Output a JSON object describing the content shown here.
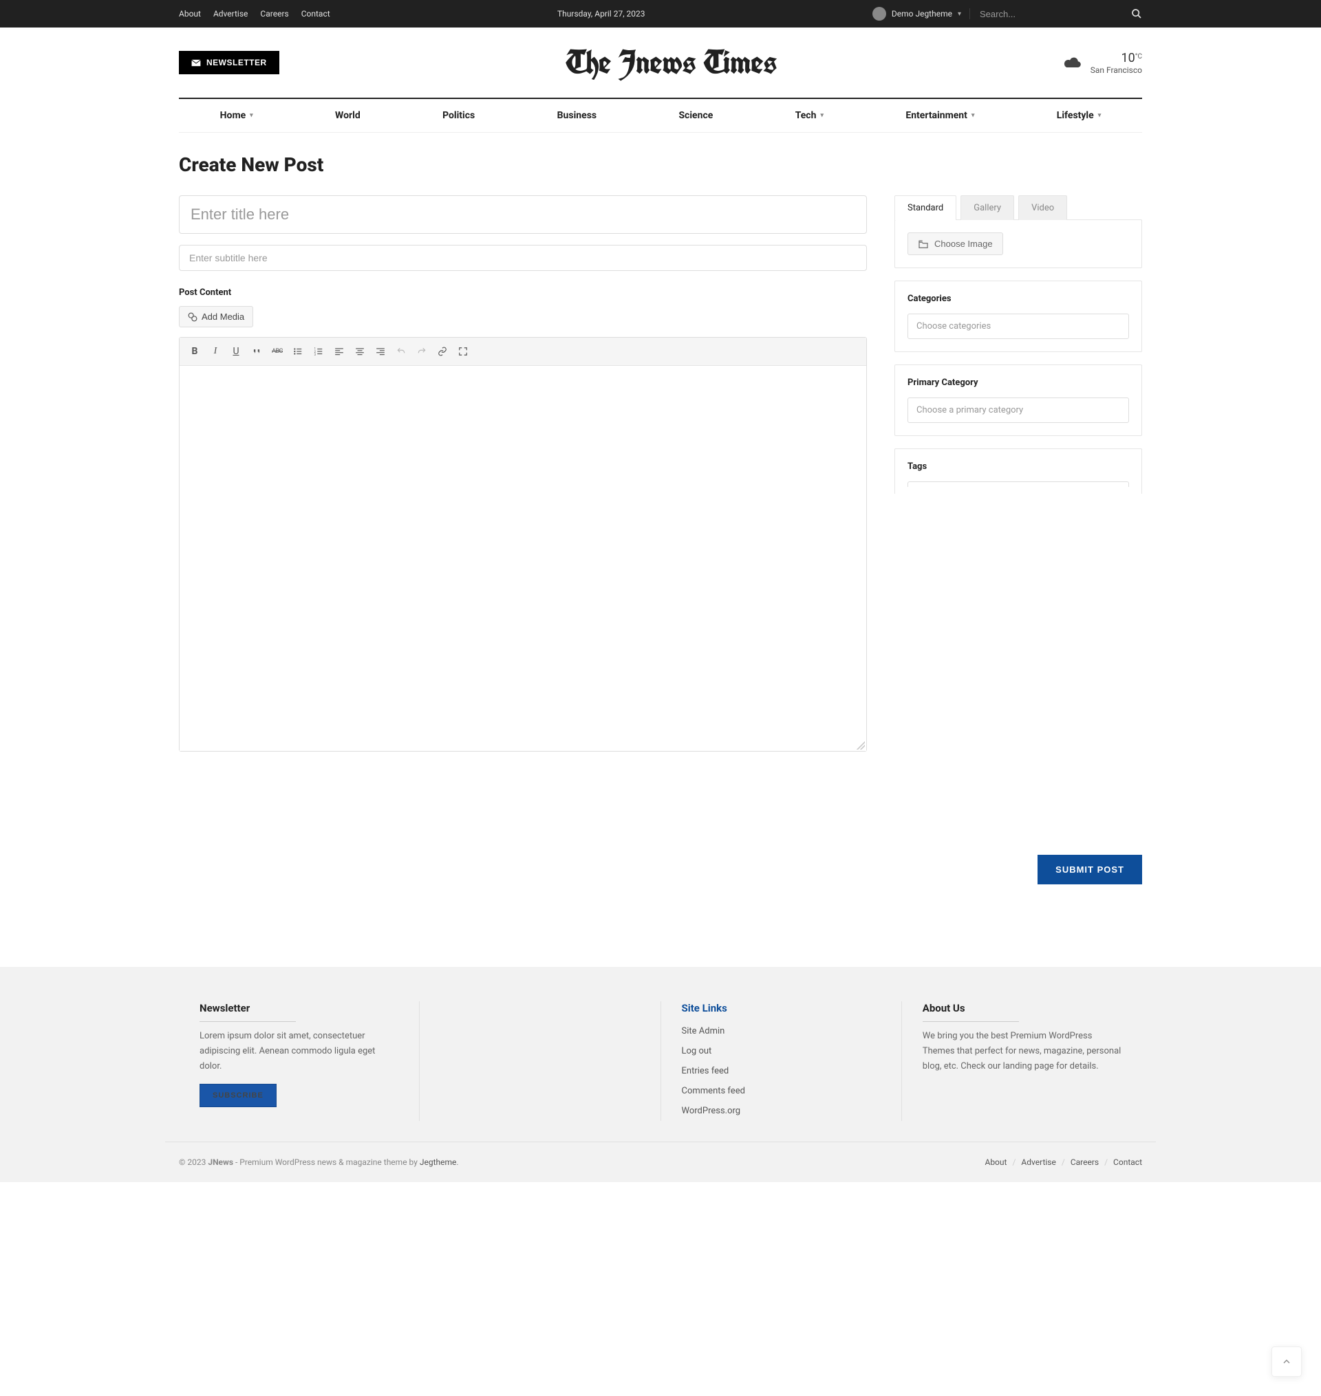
{
  "topbar": {
    "links": [
      "About",
      "Advertise",
      "Careers",
      "Contact"
    ],
    "date": "Thursday, April 27, 2023",
    "user": "Demo Jegtheme",
    "search_placeholder": "Search..."
  },
  "header": {
    "newsletter_label": "NEWSLETTER",
    "logo": "The Jnews Times",
    "weather": {
      "temp": "10",
      "unit": "°C",
      "city": "San Francisco"
    }
  },
  "nav": [
    {
      "label": "Home",
      "dropdown": true
    },
    {
      "label": "World",
      "dropdown": false
    },
    {
      "label": "Politics",
      "dropdown": false
    },
    {
      "label": "Business",
      "dropdown": false
    },
    {
      "label": "Science",
      "dropdown": false
    },
    {
      "label": "Tech",
      "dropdown": true
    },
    {
      "label": "Entertainment",
      "dropdown": true
    },
    {
      "label": "Lifestyle",
      "dropdown": true
    }
  ],
  "page": {
    "title": "Create New Post",
    "title_placeholder": "Enter title here",
    "subtitle_placeholder": "Enter subtitle here",
    "content_label": "Post Content",
    "add_media": "Add Media"
  },
  "sidebar": {
    "tabs": [
      "Standard",
      "Gallery",
      "Video"
    ],
    "choose_image": "Choose Image",
    "categories": {
      "title": "Categories",
      "placeholder": "Choose categories"
    },
    "primary": {
      "title": "Primary Category",
      "placeholder": "Choose a primary category"
    },
    "tags": {
      "title": "Tags"
    },
    "submit": "SUBMIT POST"
  },
  "footer": {
    "newsletter": {
      "title": "Newsletter",
      "text": "Lorem ipsum dolor sit amet, consectetuer adipiscing elit. Aenean commodo ligula eget dolor.",
      "button": "SUBSCRIBE"
    },
    "sitelinks": {
      "title": "Site Links",
      "items": [
        "Site Admin",
        "Log out",
        "Entries feed",
        "Comments feed",
        "WordPress.org"
      ]
    },
    "about": {
      "title": "About Us",
      "text": "We bring you the best Premium WordPress Themes that perfect for news, magazine, personal blog, etc. Check our landing page for details."
    },
    "bottom": {
      "copyright_prefix": "© 2023 ",
      "brand": "JNews",
      "copyright_suffix": " - Premium WordPress news & magazine theme by ",
      "theme_by": "Jegtheme",
      "dot": ".",
      "links": [
        "About",
        "Advertise",
        "Careers",
        "Contact"
      ]
    }
  }
}
